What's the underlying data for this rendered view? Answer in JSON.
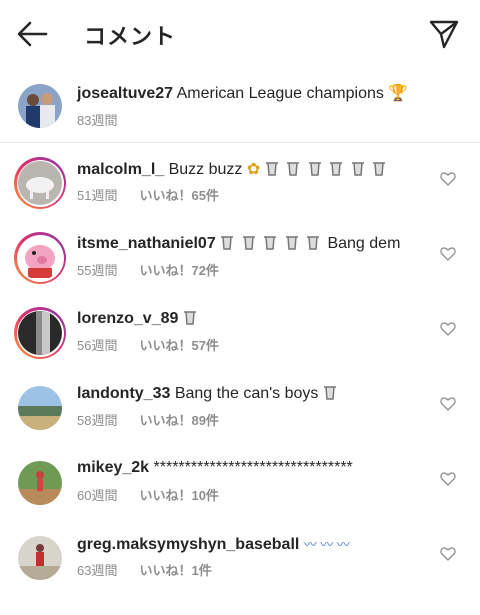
{
  "header": {
    "title": "コメント"
  },
  "caption": {
    "username": "josealtuve27",
    "text": "American League champions",
    "emoji": "🏆",
    "time": "83週間"
  },
  "comments": [
    {
      "username": "malcolm_l_",
      "text": "Buzz buzz",
      "time": "51週間",
      "likes": "いいね！65件"
    },
    {
      "username": "itsme_nathaniel07",
      "text": "Bang dem",
      "time": "55週間",
      "likes": "いいね！72件"
    },
    {
      "username": "lorenzo_v_89",
      "text": "",
      "time": "56週間",
      "likes": "いいね！57件"
    },
    {
      "username": "landonty_33",
      "text": "Bang the can's boys",
      "time": "58週間",
      "likes": "いいね！89件"
    },
    {
      "username": "mikey_2k",
      "text": "********************************",
      "time": "60週間",
      "likes": "いいね！10件"
    },
    {
      "username": "greg.maksymyshyn_baseball",
      "text": "",
      "time": "63週間",
      "likes": "いいね！1件"
    }
  ],
  "colors": {
    "story_ring": "#e1306c",
    "text": "#262626",
    "secondary": "#8e8e8e"
  }
}
